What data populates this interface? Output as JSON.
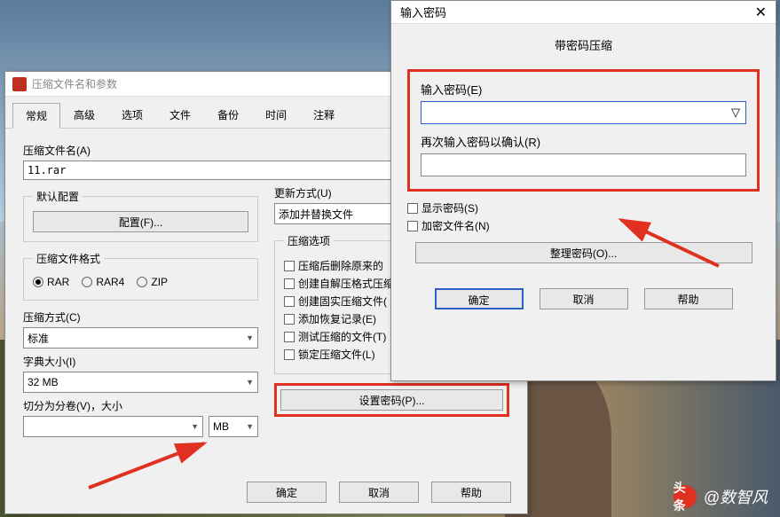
{
  "win1": {
    "title": "压缩文件名和参数",
    "tabs": [
      "常规",
      "高级",
      "选项",
      "文件",
      "备份",
      "时间",
      "注释"
    ],
    "archive_name_label": "压缩文件名(A)",
    "archive_name_value": "11.rar",
    "default_profile_label": "默认配置",
    "profile_btn": "配置(F)...",
    "update_mode_label": "更新方式(U)",
    "update_mode_value": "添加并替换文件",
    "format_label": "压缩文件格式",
    "format_rar": "RAR",
    "format_rar4": "RAR4",
    "format_zip": "ZIP",
    "method_label": "压缩方式(C)",
    "method_value": "标准",
    "dict_label": "字典大小(I)",
    "dict_value": "32 MB",
    "split_label": "切分为分卷(V)，大小",
    "split_unit": "MB",
    "options_label": "压缩选项",
    "options": [
      "压缩后删除原来的",
      "创建自解压格式压缩",
      "创建固实压缩文件(",
      "添加恢复记录(E)",
      "测试压缩的文件(T)",
      "锁定压缩文件(L)"
    ],
    "set_password_btn": "设置密码(P)...",
    "ok": "确定",
    "cancel": "取消",
    "help": "帮助"
  },
  "win2": {
    "title": "输入密码",
    "subtitle": "带密码压缩",
    "enter_pw_label": "输入密码(E)",
    "reenter_pw_label": "再次输入密码以确认(R)",
    "show_pw": "显示密码(S)",
    "encrypt_names": "加密文件名(N)",
    "organize_btn": "整理密码(O)...",
    "ok": "确定",
    "cancel": "取消",
    "help": "帮助"
  },
  "watermark": {
    "prefix": "头条",
    "text": "@数智风"
  }
}
